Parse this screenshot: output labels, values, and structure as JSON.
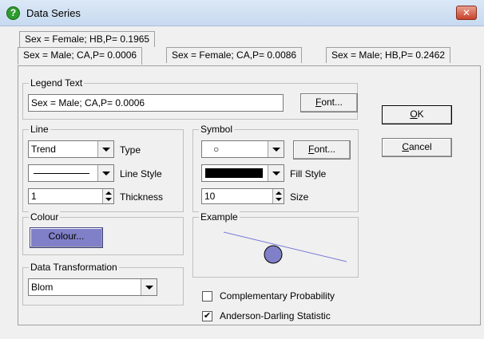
{
  "window": {
    "title": "Data Series",
    "close_glyph": "✕"
  },
  "tabs": {
    "row1": [
      {
        "label": "Sex = Female; HB,P= 0.1965"
      }
    ],
    "row2": [
      {
        "label": "Sex = Male; CA,P= 0.0006",
        "active": true
      },
      {
        "label": "Sex = Female; CA,P= 0.0086"
      },
      {
        "label": "Sex = Male; HB,P= 0.2462"
      }
    ]
  },
  "legend": {
    "group_label": "Legend Text",
    "text_value": "Sex = Male; CA,P= 0.0006",
    "font_button": {
      "underlined": "F",
      "rest": "ont..."
    }
  },
  "line": {
    "group_label": "Line",
    "type_value": "Trend",
    "type_label": "Type",
    "style_label": "Line Style",
    "thickness_value": "1",
    "thickness_label": "Thickness"
  },
  "symbol": {
    "group_label": "Symbol",
    "symbol_value": "○",
    "font_button": {
      "underlined": "F",
      "rest": "ont..."
    },
    "fill_label": "Fill Style",
    "size_value": "10",
    "size_label": "Size"
  },
  "colour": {
    "group_label": "Colour",
    "button_label": "Colour...",
    "swatch_color": "#8080c8"
  },
  "example": {
    "group_label": "Example"
  },
  "transformation": {
    "group_label": "Data Transformation",
    "value": "Blom"
  },
  "options": {
    "complementary_label": "Complementary Probability",
    "complementary_checked": false,
    "anderson_label": "Anderson-Darling Statistic",
    "anderson_checked": true
  },
  "buttons": {
    "ok": {
      "underlined": "O",
      "rest": "K"
    },
    "cancel": {
      "underlined": "C",
      "rest": "ancel"
    }
  },
  "icons": {
    "help": "help-icon",
    "close": "close-icon"
  }
}
